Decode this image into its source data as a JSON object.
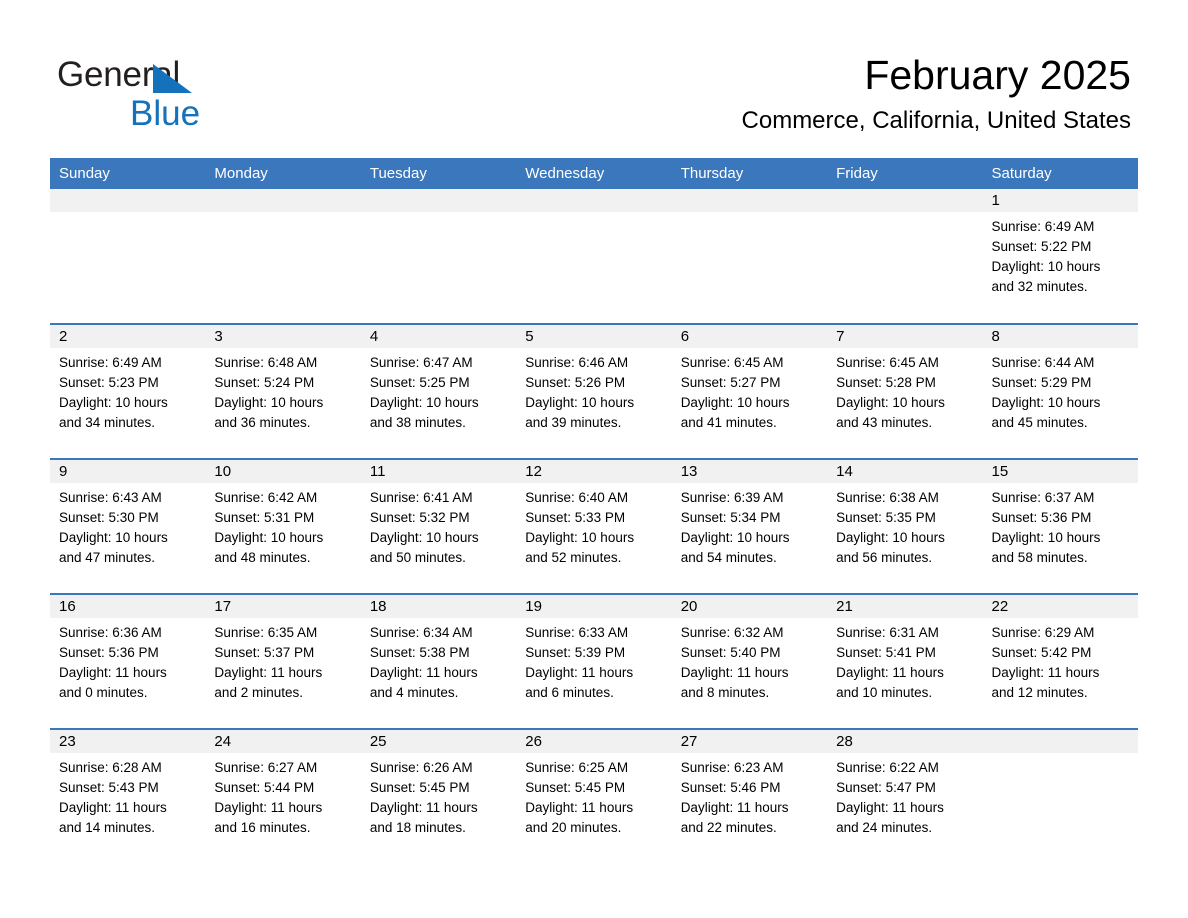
{
  "brand": {
    "name_part1": "General",
    "name_part2": "Blue",
    "triangle_color": "#1372bb"
  },
  "header": {
    "title": "February 2025",
    "subtitle": "Commerce, California, United States",
    "accent_color": "#3b77bc",
    "daynum_band_color": "#f1f1f1"
  },
  "weekdays": [
    "Sunday",
    "Monday",
    "Tuesday",
    "Wednesday",
    "Thursday",
    "Friday",
    "Saturday"
  ],
  "weeks": [
    [
      {
        "day": "",
        "sunrise": "",
        "sunset": "",
        "daylight_l1": "",
        "daylight_l2": ""
      },
      {
        "day": "",
        "sunrise": "",
        "sunset": "",
        "daylight_l1": "",
        "daylight_l2": ""
      },
      {
        "day": "",
        "sunrise": "",
        "sunset": "",
        "daylight_l1": "",
        "daylight_l2": ""
      },
      {
        "day": "",
        "sunrise": "",
        "sunset": "",
        "daylight_l1": "",
        "daylight_l2": ""
      },
      {
        "day": "",
        "sunrise": "",
        "sunset": "",
        "daylight_l1": "",
        "daylight_l2": ""
      },
      {
        "day": "",
        "sunrise": "",
        "sunset": "",
        "daylight_l1": "",
        "daylight_l2": ""
      },
      {
        "day": "1",
        "sunrise": "Sunrise: 6:49 AM",
        "sunset": "Sunset: 5:22 PM",
        "daylight_l1": "Daylight: 10 hours",
        "daylight_l2": "and 32 minutes."
      }
    ],
    [
      {
        "day": "2",
        "sunrise": "Sunrise: 6:49 AM",
        "sunset": "Sunset: 5:23 PM",
        "daylight_l1": "Daylight: 10 hours",
        "daylight_l2": "and 34 minutes."
      },
      {
        "day": "3",
        "sunrise": "Sunrise: 6:48 AM",
        "sunset": "Sunset: 5:24 PM",
        "daylight_l1": "Daylight: 10 hours",
        "daylight_l2": "and 36 minutes."
      },
      {
        "day": "4",
        "sunrise": "Sunrise: 6:47 AM",
        "sunset": "Sunset: 5:25 PM",
        "daylight_l1": "Daylight: 10 hours",
        "daylight_l2": "and 38 minutes."
      },
      {
        "day": "5",
        "sunrise": "Sunrise: 6:46 AM",
        "sunset": "Sunset: 5:26 PM",
        "daylight_l1": "Daylight: 10 hours",
        "daylight_l2": "and 39 minutes."
      },
      {
        "day": "6",
        "sunrise": "Sunrise: 6:45 AM",
        "sunset": "Sunset: 5:27 PM",
        "daylight_l1": "Daylight: 10 hours",
        "daylight_l2": "and 41 minutes."
      },
      {
        "day": "7",
        "sunrise": "Sunrise: 6:45 AM",
        "sunset": "Sunset: 5:28 PM",
        "daylight_l1": "Daylight: 10 hours",
        "daylight_l2": "and 43 minutes."
      },
      {
        "day": "8",
        "sunrise": "Sunrise: 6:44 AM",
        "sunset": "Sunset: 5:29 PM",
        "daylight_l1": "Daylight: 10 hours",
        "daylight_l2": "and 45 minutes."
      }
    ],
    [
      {
        "day": "9",
        "sunrise": "Sunrise: 6:43 AM",
        "sunset": "Sunset: 5:30 PM",
        "daylight_l1": "Daylight: 10 hours",
        "daylight_l2": "and 47 minutes."
      },
      {
        "day": "10",
        "sunrise": "Sunrise: 6:42 AM",
        "sunset": "Sunset: 5:31 PM",
        "daylight_l1": "Daylight: 10 hours",
        "daylight_l2": "and 48 minutes."
      },
      {
        "day": "11",
        "sunrise": "Sunrise: 6:41 AM",
        "sunset": "Sunset: 5:32 PM",
        "daylight_l1": "Daylight: 10 hours",
        "daylight_l2": "and 50 minutes."
      },
      {
        "day": "12",
        "sunrise": "Sunrise: 6:40 AM",
        "sunset": "Sunset: 5:33 PM",
        "daylight_l1": "Daylight: 10 hours",
        "daylight_l2": "and 52 minutes."
      },
      {
        "day": "13",
        "sunrise": "Sunrise: 6:39 AM",
        "sunset": "Sunset: 5:34 PM",
        "daylight_l1": "Daylight: 10 hours",
        "daylight_l2": "and 54 minutes."
      },
      {
        "day": "14",
        "sunrise": "Sunrise: 6:38 AM",
        "sunset": "Sunset: 5:35 PM",
        "daylight_l1": "Daylight: 10 hours",
        "daylight_l2": "and 56 minutes."
      },
      {
        "day": "15",
        "sunrise": "Sunrise: 6:37 AM",
        "sunset": "Sunset: 5:36 PM",
        "daylight_l1": "Daylight: 10 hours",
        "daylight_l2": "and 58 minutes."
      }
    ],
    [
      {
        "day": "16",
        "sunrise": "Sunrise: 6:36 AM",
        "sunset": "Sunset: 5:36 PM",
        "daylight_l1": "Daylight: 11 hours",
        "daylight_l2": "and 0 minutes."
      },
      {
        "day": "17",
        "sunrise": "Sunrise: 6:35 AM",
        "sunset": "Sunset: 5:37 PM",
        "daylight_l1": "Daylight: 11 hours",
        "daylight_l2": "and 2 minutes."
      },
      {
        "day": "18",
        "sunrise": "Sunrise: 6:34 AM",
        "sunset": "Sunset: 5:38 PM",
        "daylight_l1": "Daylight: 11 hours",
        "daylight_l2": "and 4 minutes."
      },
      {
        "day": "19",
        "sunrise": "Sunrise: 6:33 AM",
        "sunset": "Sunset: 5:39 PM",
        "daylight_l1": "Daylight: 11 hours",
        "daylight_l2": "and 6 minutes."
      },
      {
        "day": "20",
        "sunrise": "Sunrise: 6:32 AM",
        "sunset": "Sunset: 5:40 PM",
        "daylight_l1": "Daylight: 11 hours",
        "daylight_l2": "and 8 minutes."
      },
      {
        "day": "21",
        "sunrise": "Sunrise: 6:31 AM",
        "sunset": "Sunset: 5:41 PM",
        "daylight_l1": "Daylight: 11 hours",
        "daylight_l2": "and 10 minutes."
      },
      {
        "day": "22",
        "sunrise": "Sunrise: 6:29 AM",
        "sunset": "Sunset: 5:42 PM",
        "daylight_l1": "Daylight: 11 hours",
        "daylight_l2": "and 12 minutes."
      }
    ],
    [
      {
        "day": "23",
        "sunrise": "Sunrise: 6:28 AM",
        "sunset": "Sunset: 5:43 PM",
        "daylight_l1": "Daylight: 11 hours",
        "daylight_l2": "and 14 minutes."
      },
      {
        "day": "24",
        "sunrise": "Sunrise: 6:27 AM",
        "sunset": "Sunset: 5:44 PM",
        "daylight_l1": "Daylight: 11 hours",
        "daylight_l2": "and 16 minutes."
      },
      {
        "day": "25",
        "sunrise": "Sunrise: 6:26 AM",
        "sunset": "Sunset: 5:45 PM",
        "daylight_l1": "Daylight: 11 hours",
        "daylight_l2": "and 18 minutes."
      },
      {
        "day": "26",
        "sunrise": "Sunrise: 6:25 AM",
        "sunset": "Sunset: 5:45 PM",
        "daylight_l1": "Daylight: 11 hours",
        "daylight_l2": "and 20 minutes."
      },
      {
        "day": "27",
        "sunrise": "Sunrise: 6:23 AM",
        "sunset": "Sunset: 5:46 PM",
        "daylight_l1": "Daylight: 11 hours",
        "daylight_l2": "and 22 minutes."
      },
      {
        "day": "28",
        "sunrise": "Sunrise: 6:22 AM",
        "sunset": "Sunset: 5:47 PM",
        "daylight_l1": "Daylight: 11 hours",
        "daylight_l2": "and 24 minutes."
      },
      {
        "day": "",
        "sunrise": "",
        "sunset": "",
        "daylight_l1": "",
        "daylight_l2": ""
      }
    ]
  ]
}
